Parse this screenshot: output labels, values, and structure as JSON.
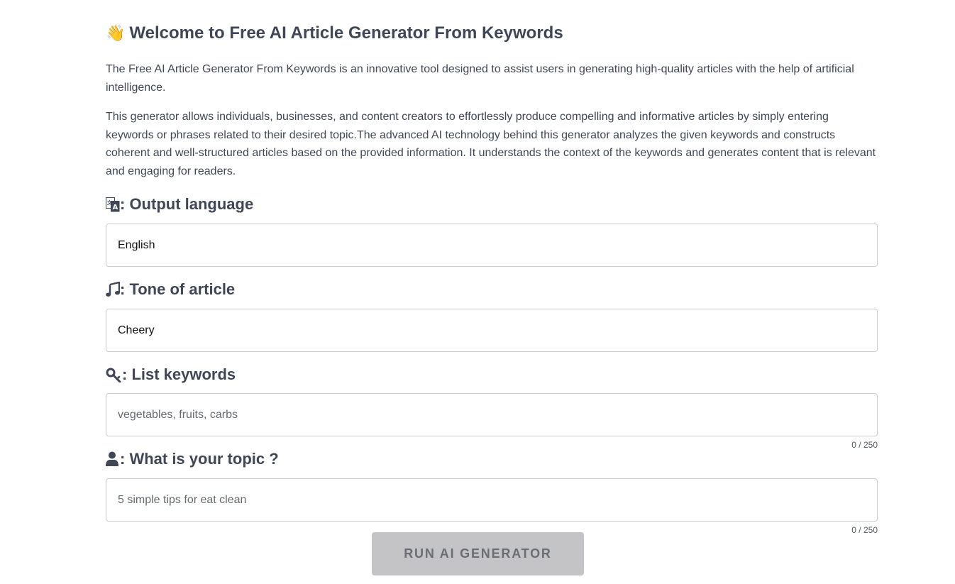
{
  "header": {
    "title_icon": "waving-hand-emoji",
    "title_icon_glyph": "👋",
    "title": "Welcome to Free AI Article Generator From Keywords"
  },
  "intro": {
    "paragraph1": "The Free AI Article Generator From Keywords is an innovative tool designed to assist users in generating high-quality articles with the help of artificial intelligence.",
    "paragraph2": "This generator allows individuals, businesses, and content creators to effortlessly produce compelling and informative articles by simply entering keywords or phrases related to their desired topic.The advanced AI technology behind this generator analyzes the given keywords and constructs coherent and well-structured articles based on the provided information. It understands the context of the keywords and generates content that is relevant and engaging for readers."
  },
  "form": {
    "language": {
      "icon": "language-icon",
      "label": ": Output language",
      "value": "English"
    },
    "tone": {
      "icon": "music-note-icon",
      "label": ": Tone of article",
      "value": "Cheery"
    },
    "keywords": {
      "icon": "key-icon",
      "label": ": List keywords",
      "placeholder": "vegetables, fruits, carbs",
      "value": "",
      "counter": "0 / 250"
    },
    "topic": {
      "icon": "user-icon",
      "label": ": What is your topic ?",
      "placeholder": "5 simple tips for eat clean",
      "value": "",
      "counter": "0 / 250"
    },
    "run_label": "RUN AI GENERATOR"
  },
  "colors": {
    "text": "#3f4756",
    "border": "#c9cdd3",
    "button_bg": "#c4c4c6",
    "button_text": "#6a6d72"
  }
}
